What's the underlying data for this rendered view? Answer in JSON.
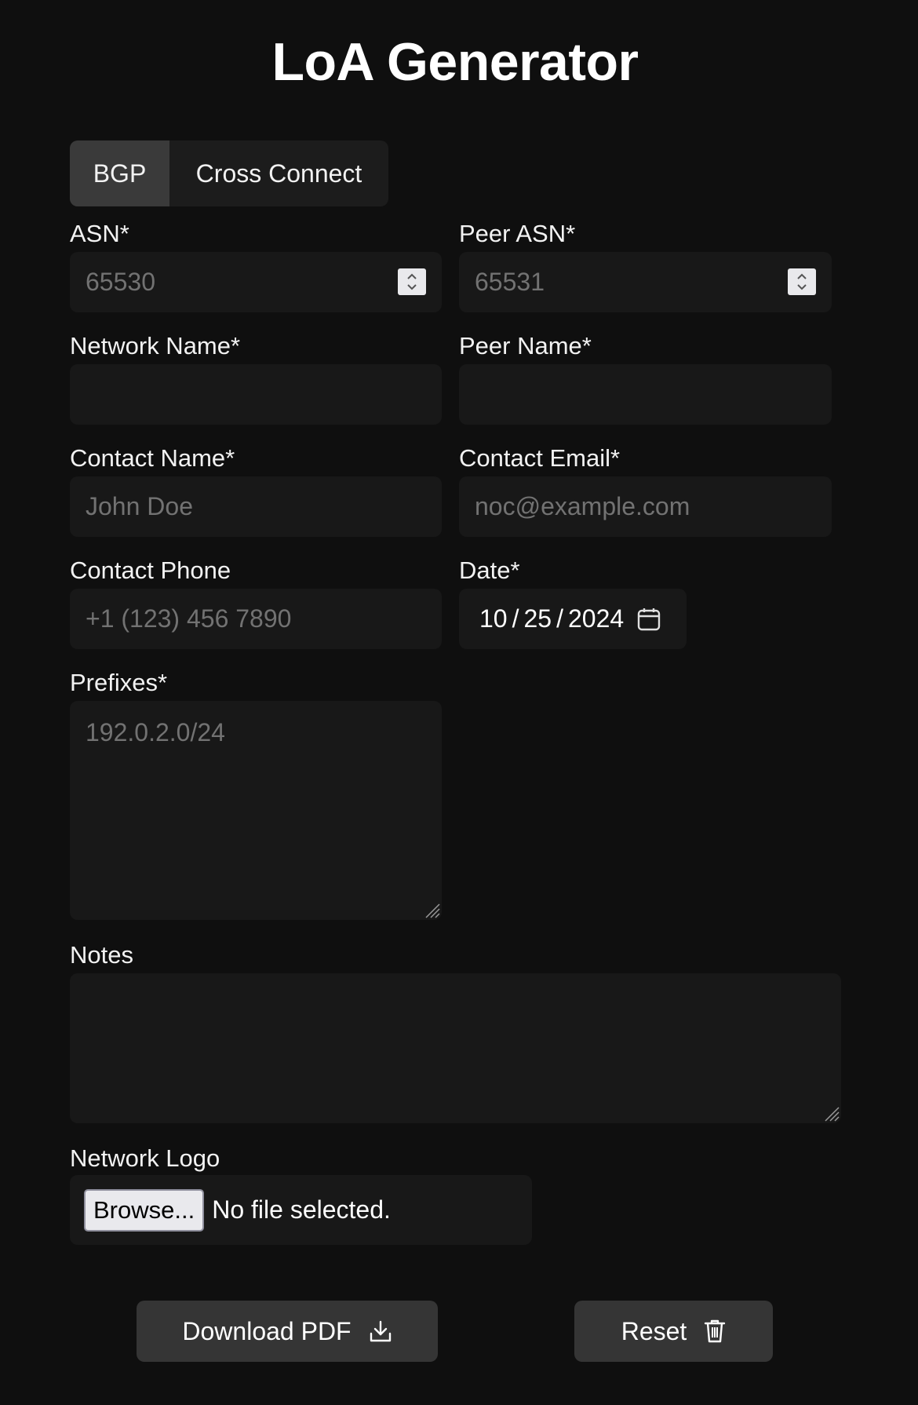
{
  "app": {
    "title": "LoA Generator"
  },
  "tabs": [
    {
      "label": "BGP",
      "active": true
    },
    {
      "label": "Cross Connect",
      "active": false
    }
  ],
  "form": {
    "asn": {
      "label": "ASN*",
      "placeholder": "65530"
    },
    "peer_asn": {
      "label": "Peer ASN*",
      "placeholder": "65531"
    },
    "network_name": {
      "label": "Network Name*",
      "value": ""
    },
    "peer_name": {
      "label": "Peer Name*",
      "value": ""
    },
    "contact_name": {
      "label": "Contact Name*",
      "placeholder": "John Doe"
    },
    "contact_email": {
      "label": "Contact Email*",
      "placeholder": "noc@example.com"
    },
    "contact_phone": {
      "label": "Contact Phone",
      "placeholder": "+1 (123) 456 7890"
    },
    "date": {
      "label": "Date*",
      "month": "10",
      "day": "25",
      "year": "2024",
      "sep": "/"
    },
    "prefixes": {
      "label": "Prefixes*",
      "placeholder": "192.0.2.0/24"
    },
    "notes": {
      "label": "Notes",
      "value": ""
    },
    "logo": {
      "label": "Network Logo",
      "browse_label": "Browse...",
      "status": "No file selected."
    }
  },
  "actions": {
    "download": {
      "label": "Download PDF",
      "icon": "download-icon"
    },
    "reset": {
      "label": "Reset",
      "icon": "trash-icon"
    }
  },
  "colors": {
    "background": "#0f0f0f",
    "field": "#181818",
    "button": "#353535",
    "tab_active": "#3a3a3a"
  }
}
